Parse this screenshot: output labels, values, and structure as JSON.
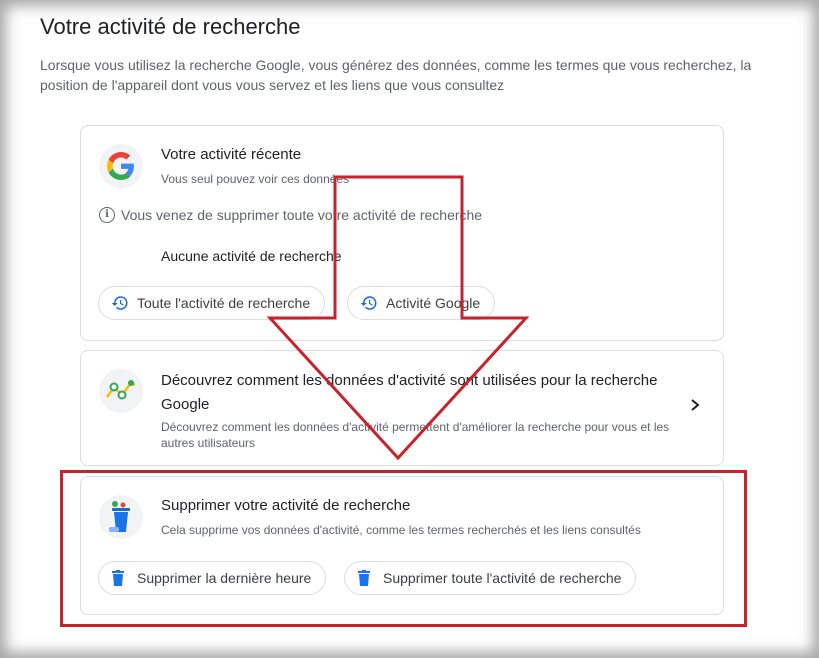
{
  "page": {
    "title": "Votre activité de recherche",
    "description": "Lorsque vous utilisez la recherche Google, vous générez des données, comme les termes que vous recherchez, la position de l'appareil dont vous vous servez et les liens que vous consultez"
  },
  "recent_card": {
    "title": "Votre activité récente",
    "subtitle": "Vous seul pouvez voir ces données",
    "info": "Vous venez de supprimer toute votre activité de recherche",
    "empty_text": "Aucune activité de recherche",
    "buttons": [
      "Toute l'activité de recherche",
      "Activité Google"
    ]
  },
  "discover_card": {
    "title": "Découvrez comment les données d'activité sont utilisées pour la recherche Google",
    "subtitle": "Découvrez comment les données d'activité permettent d'améliorer la recherche pour vous et les autres utilisateurs"
  },
  "delete_card": {
    "title": "Supprimer votre activité de recherche",
    "subtitle": "Cela supprime vos données d'activité, comme les termes recherchés et les liens consultés",
    "buttons": [
      "Supprimer la dernière heure",
      "Supprimer toute l'activité de recherche"
    ]
  },
  "colors": {
    "annotation_red": "#c8232c",
    "accent_blue": "#1a73e8",
    "history_icon": "#1967d2"
  }
}
